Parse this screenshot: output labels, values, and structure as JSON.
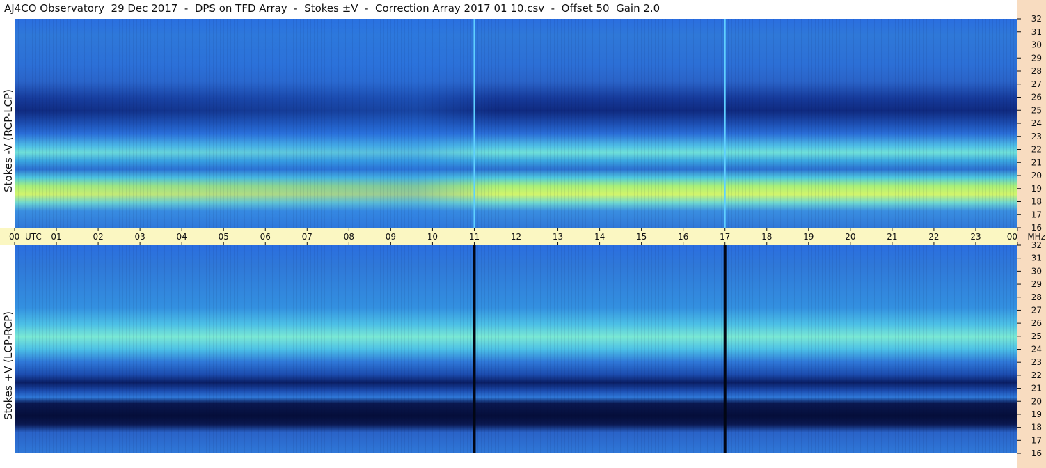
{
  "title": "AJ4CO Observatory  29 Dec 2017  -  DPS on TFD Array  -  Stokes ±V  -  Correction Array 2017 01 10.csv  -  Offset 50  Gain 2.0",
  "chart_data": [
    {
      "type": "heatmap",
      "panel": "top",
      "ylabel": "Stokes -V (RCP-LCP)",
      "x_ticks": [
        "00",
        "01",
        "02",
        "03",
        "04",
        "05",
        "06",
        "07",
        "08",
        "09",
        "10",
        "11",
        "12",
        "13",
        "14",
        "15",
        "16",
        "17",
        "18",
        "19",
        "20",
        "21",
        "22",
        "23",
        "00"
      ],
      "x_unit": "UTC",
      "xlim": [
        0,
        24
      ],
      "y_ticks": [
        "16",
        "17",
        "18",
        "19",
        "20",
        "21",
        "22",
        "23",
        "24",
        "25",
        "26",
        "27",
        "28",
        "29",
        "30",
        "31",
        "32"
      ],
      "y_unit": "MHz",
      "ylim": [
        16,
        32
      ],
      "colors": {
        "background": "#2f78d8"
      }
    },
    {
      "type": "heatmap",
      "panel": "bottom",
      "ylabel": "Stokes +V (LCP-RCP)",
      "y_ticks": [
        "16",
        "17",
        "18",
        "19",
        "20",
        "21",
        "22",
        "23",
        "24",
        "25",
        "26",
        "27",
        "28",
        "29",
        "30",
        "31",
        "32"
      ],
      "y_unit": "MHz",
      "ylim": [
        16,
        32
      ],
      "colors": {
        "background": "#2f78d8"
      }
    }
  ]
}
